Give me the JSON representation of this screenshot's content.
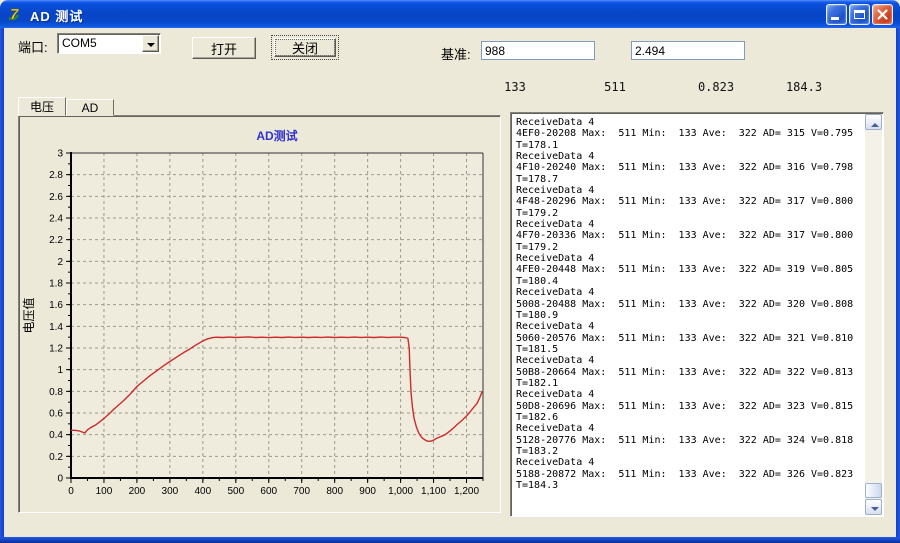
{
  "window": {
    "title": "AD 测试",
    "icons": {
      "app_icon": "stylized-7-logo",
      "minimize": "minimize-bar",
      "maximize": "window-outline",
      "close": "x-cross"
    }
  },
  "toolbar": {
    "port_label": "端口:",
    "port_value": "COM5",
    "open_button": "打开",
    "close_button": "关闭",
    "baseline_label": "基准:",
    "baseline_value_1": "988",
    "baseline_value_2": "2.494"
  },
  "stats": {
    "min": "133",
    "max": "511",
    "voltage": "0.823",
    "temperature": "184.3"
  },
  "tabs": [
    {
      "label": "电压",
      "active": true
    },
    {
      "label": "AD",
      "active": false
    }
  ],
  "chart_data": {
    "type": "line",
    "title": "AD测试",
    "title_color": "#3333cc",
    "ylabel": "电压值",
    "xlabel": "",
    "xlim": [
      0,
      1250
    ],
    "ylim": [
      0,
      3
    ],
    "grid": true,
    "grid_style": "dashed",
    "line_color": "#cc2a2a",
    "plot_bg": "#efecdd",
    "x_ticks": [
      {
        "v": 0,
        "label": "0"
      },
      {
        "v": 100,
        "label": "100"
      },
      {
        "v": 200,
        "label": "200"
      },
      {
        "v": 300,
        "label": "300"
      },
      {
        "v": 400,
        "label": "400"
      },
      {
        "v": 500,
        "label": "500"
      },
      {
        "v": 600,
        "label": "600"
      },
      {
        "v": 700,
        "label": "700"
      },
      {
        "v": 800,
        "label": "800"
      },
      {
        "v": 900,
        "label": "900"
      },
      {
        "v": 1000,
        "label": "1,000"
      },
      {
        "v": 1100,
        "label": "1,100"
      },
      {
        "v": 1200,
        "label": "1,200"
      }
    ],
    "x_minor_step": 50,
    "y_ticks": [
      {
        "v": 0,
        "label": "0"
      },
      {
        "v": 0.2,
        "label": "0.2"
      },
      {
        "v": 0.4,
        "label": "0.4"
      },
      {
        "v": 0.6,
        "label": "0.6"
      },
      {
        "v": 0.8,
        "label": "0.8"
      },
      {
        "v": 1,
        "label": "1"
      },
      {
        "v": 1.2,
        "label": "1.2"
      },
      {
        "v": 1.4,
        "label": "1.4"
      },
      {
        "v": 1.6,
        "label": "1.6"
      },
      {
        "v": 1.8,
        "label": "1.8"
      },
      {
        "v": 2,
        "label": "2"
      },
      {
        "v": 2.2,
        "label": "2.2"
      },
      {
        "v": 2.4,
        "label": "2.4"
      },
      {
        "v": 2.6,
        "label": "2.6"
      },
      {
        "v": 2.8,
        "label": "2.8"
      },
      {
        "v": 3,
        "label": "3"
      }
    ],
    "y_minor_step": 0.1,
    "series": [
      {
        "name": "电压",
        "points": [
          [
            0,
            0.44
          ],
          [
            12,
            0.44
          ],
          [
            25,
            0.435
          ],
          [
            38,
            0.42
          ],
          [
            42,
            0.415
          ],
          [
            50,
            0.445
          ],
          [
            60,
            0.465
          ],
          [
            75,
            0.49
          ],
          [
            90,
            0.525
          ],
          [
            100,
            0.55
          ],
          [
            115,
            0.59
          ],
          [
            130,
            0.635
          ],
          [
            145,
            0.675
          ],
          [
            160,
            0.715
          ],
          [
            180,
            0.775
          ],
          [
            200,
            0.845
          ],
          [
            220,
            0.895
          ],
          [
            240,
            0.945
          ],
          [
            260,
            0.99
          ],
          [
            280,
            1.035
          ],
          [
            300,
            1.075
          ],
          [
            320,
            1.115
          ],
          [
            340,
            1.155
          ],
          [
            360,
            1.19
          ],
          [
            380,
            1.23
          ],
          [
            400,
            1.265
          ],
          [
            415,
            1.285
          ],
          [
            428,
            1.295
          ],
          [
            440,
            1.3
          ],
          [
            460,
            1.297
          ],
          [
            480,
            1.301
          ],
          [
            500,
            1.297
          ],
          [
            520,
            1.3
          ],
          [
            540,
            1.302
          ],
          [
            560,
            1.297
          ],
          [
            580,
            1.3
          ],
          [
            600,
            1.296
          ],
          [
            620,
            1.3
          ],
          [
            640,
            1.297
          ],
          [
            660,
            1.301
          ],
          [
            680,
            1.298
          ],
          [
            700,
            1.3
          ],
          [
            720,
            1.297
          ],
          [
            740,
            1.3
          ],
          [
            760,
            1.298
          ],
          [
            780,
            1.301
          ],
          [
            800,
            1.297
          ],
          [
            820,
            1.3
          ],
          [
            840,
            1.298
          ],
          [
            860,
            1.301
          ],
          [
            880,
            1.298
          ],
          [
            900,
            1.3
          ],
          [
            920,
            1.297
          ],
          [
            940,
            1.301
          ],
          [
            960,
            1.298
          ],
          [
            980,
            1.3
          ],
          [
            1000,
            1.3
          ],
          [
            1012,
            1.297
          ],
          [
            1022,
            1.29
          ],
          [
            1026,
            1.2
          ],
          [
            1029,
            0.95
          ],
          [
            1032,
            0.78
          ],
          [
            1036,
            0.65
          ],
          [
            1041,
            0.55
          ],
          [
            1048,
            0.47
          ],
          [
            1056,
            0.41
          ],
          [
            1064,
            0.375
          ],
          [
            1072,
            0.355
          ],
          [
            1082,
            0.34
          ],
          [
            1092,
            0.34
          ],
          [
            1100,
            0.35
          ],
          [
            1108,
            0.365
          ],
          [
            1116,
            0.375
          ],
          [
            1124,
            0.385
          ],
          [
            1132,
            0.395
          ],
          [
            1140,
            0.41
          ],
          [
            1150,
            0.435
          ],
          [
            1160,
            0.46
          ],
          [
            1172,
            0.495
          ],
          [
            1184,
            0.525
          ],
          [
            1196,
            0.56
          ],
          [
            1208,
            0.6
          ],
          [
            1220,
            0.645
          ],
          [
            1232,
            0.69
          ],
          [
            1240,
            0.74
          ],
          [
            1248,
            0.8
          ]
        ]
      }
    ]
  },
  "log": {
    "lines": [
      "ReceiveData 4",
      "4EF0-20208 Max:  511 Min:  133 Ave:  322 AD= 315 V=0.795",
      "T=178.1",
      "ReceiveData 4",
      "4F10-20240 Max:  511 Min:  133 Ave:  322 AD= 316 V=0.798",
      "T=178.7",
      "ReceiveData 4",
      "4F48-20296 Max:  511 Min:  133 Ave:  322 AD= 317 V=0.800",
      "T=179.2",
      "ReceiveData 4",
      "4F70-20336 Max:  511 Min:  133 Ave:  322 AD= 317 V=0.800",
      "T=179.2",
      "ReceiveData 4",
      "4FE0-20448 Max:  511 Min:  133 Ave:  322 AD= 319 V=0.805",
      "T=180.4",
      "ReceiveData 4",
      "5008-20488 Max:  511 Min:  133 Ave:  322 AD= 320 V=0.808",
      "T=180.9",
      "ReceiveData 4",
      "5060-20576 Max:  511 Min:  133 Ave:  322 AD= 321 V=0.810",
      "T=181.5",
      "ReceiveData 4",
      "50B8-20664 Max:  511 Min:  133 Ave:  322 AD= 322 V=0.813",
      "T=182.1",
      "ReceiveData 4",
      "50D8-20696 Max:  511 Min:  133 Ave:  322 AD= 323 V=0.815",
      "T=182.6",
      "ReceiveData 4",
      "5128-20776 Max:  511 Min:  133 Ave:  322 AD= 324 V=0.818",
      "T=183.2",
      "ReceiveData 4",
      "5188-20872 Max:  511 Min:  133 Ave:  322 AD= 326 V=0.823",
      "T=184.3"
    ]
  }
}
